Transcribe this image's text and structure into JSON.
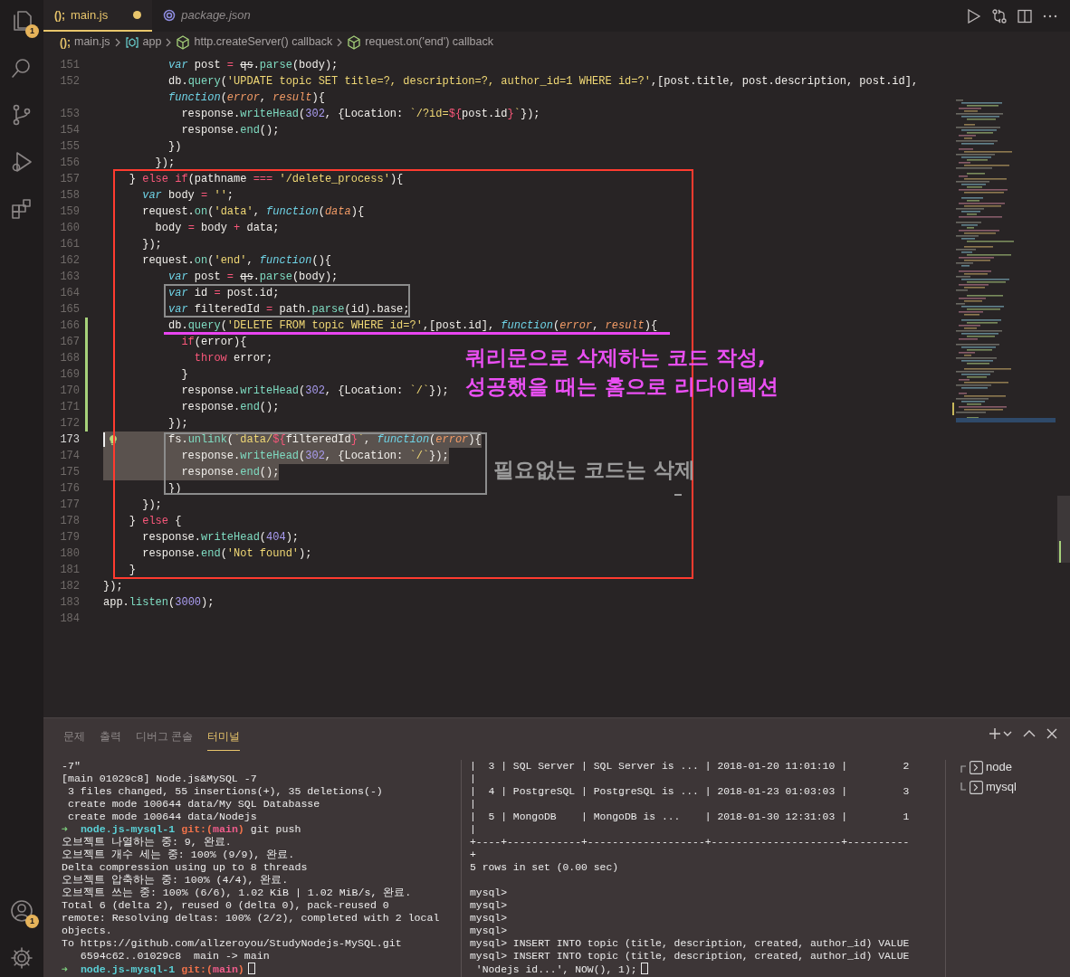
{
  "activity_bar": {
    "top": [
      {
        "kind": "explorer",
        "badge": "1"
      },
      {
        "kind": "search"
      },
      {
        "kind": "source-control"
      },
      {
        "kind": "run"
      },
      {
        "kind": "extensions"
      }
    ],
    "bottom": [
      {
        "kind": "accounts",
        "badge": "1"
      },
      {
        "kind": "settings"
      }
    ]
  },
  "editor": {
    "tabs": [
      {
        "label": "main.js",
        "kind": "js",
        "icon_text": "();",
        "modified": true,
        "preview": false,
        "selected": true
      },
      {
        "label": "package.json",
        "kind": "json",
        "modified": false,
        "preview": true,
        "selected": false
      }
    ],
    "breadcrumbs": [
      {
        "label": "main.js",
        "kind": "file",
        "icon_text": "();"
      },
      {
        "label": "app",
        "kind": "variable"
      },
      {
        "label": "http.createServer() callback",
        "kind": "method"
      },
      {
        "label": "request.on('end') callback",
        "kind": "method"
      }
    ],
    "lines": [
      {
        "number": "151",
        "modified": false,
        "current": false,
        "selected": false,
        "tokens": [
          {
            "kind": "st",
            "text": "          var"
          },
          {
            "kind": "p",
            "text": " post "
          },
          {
            "kind": "op",
            "text": "= "
          },
          {
            "kind": "x",
            "text": "qs"
          },
          {
            "kind": "p",
            "text": "."
          },
          {
            "kind": "fn",
            "text": "parse"
          },
          {
            "kind": "p",
            "text": "(body);"
          }
        ]
      },
      {
        "number": "152",
        "modified": false,
        "current": false,
        "selected": false,
        "tokens": [
          {
            "kind": "p",
            "text": "          db."
          },
          {
            "kind": "fn",
            "text": "query"
          },
          {
            "kind": "p",
            "text": "("
          },
          {
            "kind": "s",
            "text": "'UPDATE topic SET title=?, description=?, author_id=1 WHERE id=?'"
          },
          {
            "kind": "p",
            "text": ",[post.title, post.description, post.id],"
          }
        ],
        "wrap_tokens": [
          {
            "kind": "st",
            "text": "          function"
          },
          {
            "kind": "p",
            "text": "("
          },
          {
            "kind": "pa",
            "text": "error"
          },
          {
            "kind": "p",
            "text": ", "
          },
          {
            "kind": "pa",
            "text": "result"
          },
          {
            "kind": "p",
            "text": "){"
          }
        ]
      },
      {
        "number": "153",
        "modified": false,
        "current": false,
        "selected": false,
        "tokens": [
          {
            "kind": "p",
            "text": "            response."
          },
          {
            "kind": "fn",
            "text": "writeHead"
          },
          {
            "kind": "p",
            "text": "("
          },
          {
            "kind": "n",
            "text": "302"
          },
          {
            "kind": "p",
            "text": ", {Location: "
          },
          {
            "kind": "s",
            "text": "`/?id="
          },
          {
            "kind": "op",
            "text": "${"
          },
          {
            "kind": "p",
            "text": "post.id"
          },
          {
            "kind": "op",
            "text": "}"
          },
          {
            "kind": "s",
            "text": "`"
          },
          {
            "kind": "p",
            "text": "});"
          }
        ]
      },
      {
        "number": "154",
        "modified": false,
        "current": false,
        "selected": false,
        "tokens": [
          {
            "kind": "p",
            "text": "            response."
          },
          {
            "kind": "fn",
            "text": "end"
          },
          {
            "kind": "p",
            "text": "();"
          }
        ]
      },
      {
        "number": "155",
        "modified": false,
        "current": false,
        "selected": false,
        "tokens": [
          {
            "kind": "p",
            "text": "          })"
          }
        ]
      },
      {
        "number": "156",
        "modified": false,
        "current": false,
        "selected": false,
        "tokens": [
          {
            "kind": "p",
            "text": "        });"
          }
        ]
      },
      {
        "number": "157",
        "modified": false,
        "current": false,
        "selected": false,
        "tokens": [
          {
            "kind": "p",
            "text": "    } "
          },
          {
            "kind": "op",
            "text": "else if"
          },
          {
            "kind": "p",
            "text": "(pathname "
          },
          {
            "kind": "op",
            "text": "=== "
          },
          {
            "kind": "s",
            "text": "'/delete_process'"
          },
          {
            "kind": "p",
            "text": "){"
          }
        ]
      },
      {
        "number": "158",
        "modified": false,
        "current": false,
        "selected": false,
        "tokens": [
          {
            "kind": "st",
            "text": "      var"
          },
          {
            "kind": "p",
            "text": " body "
          },
          {
            "kind": "op",
            "text": "= "
          },
          {
            "kind": "s",
            "text": "''"
          },
          {
            "kind": "p",
            "text": ";"
          }
        ]
      },
      {
        "number": "159",
        "modified": false,
        "current": false,
        "selected": false,
        "tokens": [
          {
            "kind": "p",
            "text": "      request."
          },
          {
            "kind": "fn",
            "text": "on"
          },
          {
            "kind": "p",
            "text": "("
          },
          {
            "kind": "s",
            "text": "'data'"
          },
          {
            "kind": "p",
            "text": ", "
          },
          {
            "kind": "st",
            "text": "function"
          },
          {
            "kind": "p",
            "text": "("
          },
          {
            "kind": "pa",
            "text": "data"
          },
          {
            "kind": "p",
            "text": "){"
          }
        ]
      },
      {
        "number": "160",
        "modified": false,
        "current": false,
        "selected": false,
        "tokens": [
          {
            "kind": "p",
            "text": "        body "
          },
          {
            "kind": "op",
            "text": "="
          },
          {
            "kind": "p",
            "text": " body "
          },
          {
            "kind": "op",
            "text": "+"
          },
          {
            "kind": "p",
            "text": " data;"
          }
        ]
      },
      {
        "number": "161",
        "modified": false,
        "current": false,
        "selected": false,
        "tokens": [
          {
            "kind": "p",
            "text": "      });"
          }
        ]
      },
      {
        "number": "162",
        "modified": false,
        "current": false,
        "selected": false,
        "tokens": [
          {
            "kind": "p",
            "text": "      request."
          },
          {
            "kind": "fn",
            "text": "on"
          },
          {
            "kind": "p",
            "text": "("
          },
          {
            "kind": "s",
            "text": "'end'"
          },
          {
            "kind": "p",
            "text": ", "
          },
          {
            "kind": "st",
            "text": "function"
          },
          {
            "kind": "p",
            "text": "(){"
          }
        ]
      },
      {
        "number": "163",
        "modified": false,
        "current": false,
        "selected": false,
        "tokens": [
          {
            "kind": "st",
            "text": "          var"
          },
          {
            "kind": "p",
            "text": " post "
          },
          {
            "kind": "op",
            "text": "= "
          },
          {
            "kind": "x",
            "text": "qs"
          },
          {
            "kind": "p",
            "text": "."
          },
          {
            "kind": "fn",
            "text": "parse"
          },
          {
            "kind": "p",
            "text": "(body);"
          }
        ]
      },
      {
        "number": "164",
        "modified": false,
        "current": false,
        "selected": false,
        "tokens": [
          {
            "kind": "st",
            "text": "          var"
          },
          {
            "kind": "p",
            "text": " id "
          },
          {
            "kind": "op",
            "text": "="
          },
          {
            "kind": "p",
            "text": " post.id;"
          }
        ]
      },
      {
        "number": "165",
        "modified": false,
        "current": false,
        "selected": false,
        "tokens": [
          {
            "kind": "st",
            "text": "          var"
          },
          {
            "kind": "p",
            "text": " filteredId "
          },
          {
            "kind": "op",
            "text": "="
          },
          {
            "kind": "p",
            "text": " path."
          },
          {
            "kind": "fn",
            "text": "parse"
          },
          {
            "kind": "p",
            "text": "(id).base;"
          }
        ]
      },
      {
        "number": "166",
        "modified": true,
        "current": false,
        "selected": false,
        "tokens": [
          {
            "kind": "p",
            "text": "          db."
          },
          {
            "kind": "fn",
            "text": "query"
          },
          {
            "kind": "p",
            "text": "("
          },
          {
            "kind": "s",
            "text": "'DELETE FROM topic WHERE id=?'"
          },
          {
            "kind": "p",
            "text": ",[post.id], "
          },
          {
            "kind": "st",
            "text": "function"
          },
          {
            "kind": "p",
            "text": "("
          },
          {
            "kind": "pa",
            "text": "error"
          },
          {
            "kind": "p",
            "text": ", "
          },
          {
            "kind": "pa",
            "text": "result"
          },
          {
            "kind": "p",
            "text": "){"
          }
        ]
      },
      {
        "number": "167",
        "modified": true,
        "current": false,
        "selected": false,
        "tokens": [
          {
            "kind": "op",
            "text": "            if"
          },
          {
            "kind": "p",
            "text": "(error){"
          }
        ]
      },
      {
        "number": "168",
        "modified": true,
        "current": false,
        "selected": false,
        "tokens": [
          {
            "kind": "op",
            "text": "              throw"
          },
          {
            "kind": "p",
            "text": " error;"
          }
        ]
      },
      {
        "number": "169",
        "modified": true,
        "current": false,
        "selected": false,
        "tokens": [
          {
            "kind": "p",
            "text": "            }"
          }
        ]
      },
      {
        "number": "170",
        "modified": true,
        "current": false,
        "selected": false,
        "tokens": [
          {
            "kind": "p",
            "text": "            response."
          },
          {
            "kind": "fn",
            "text": "writeHead"
          },
          {
            "kind": "p",
            "text": "("
          },
          {
            "kind": "n",
            "text": "302"
          },
          {
            "kind": "p",
            "text": ", {Location: "
          },
          {
            "kind": "s",
            "text": "`/`"
          },
          {
            "kind": "p",
            "text": "});"
          }
        ]
      },
      {
        "number": "171",
        "modified": true,
        "current": false,
        "selected": false,
        "tokens": [
          {
            "kind": "p",
            "text": "            response."
          },
          {
            "kind": "fn",
            "text": "end"
          },
          {
            "kind": "p",
            "text": "();"
          }
        ]
      },
      {
        "number": "172",
        "modified": true,
        "current": false,
        "selected": false,
        "tokens": [
          {
            "kind": "p",
            "text": "          });"
          }
        ]
      },
      {
        "number": "173",
        "modified": false,
        "current": true,
        "selected": true,
        "tokens": [
          {
            "kind": "p",
            "text": "          fs."
          },
          {
            "kind": "fn",
            "text": "unlink"
          },
          {
            "kind": "p",
            "text": "("
          },
          {
            "kind": "s",
            "text": "`data/"
          },
          {
            "kind": "op",
            "text": "${"
          },
          {
            "kind": "p",
            "text": "filteredId"
          },
          {
            "kind": "op",
            "text": "}"
          },
          {
            "kind": "s",
            "text": "`"
          },
          {
            "kind": "p",
            "text": ", "
          },
          {
            "kind": "st",
            "text": "function"
          },
          {
            "kind": "p",
            "text": "("
          },
          {
            "kind": "pa",
            "text": "error"
          },
          {
            "kind": "p",
            "text": "){"
          }
        ]
      },
      {
        "number": "174",
        "modified": false,
        "current": false,
        "selected": true,
        "tokens": [
          {
            "kind": "p",
            "text": "            response."
          },
          {
            "kind": "fn",
            "text": "writeHead"
          },
          {
            "kind": "p",
            "text": "("
          },
          {
            "kind": "n",
            "text": "302"
          },
          {
            "kind": "p",
            "text": ", {Location: "
          },
          {
            "kind": "s",
            "text": "`/`"
          },
          {
            "kind": "p",
            "text": "});"
          }
        ]
      },
      {
        "number": "175",
        "modified": false,
        "current": false,
        "selected": true,
        "tokens": [
          {
            "kind": "p",
            "text": "            response."
          },
          {
            "kind": "fn",
            "text": "end"
          },
          {
            "kind": "p",
            "text": "();"
          }
        ]
      },
      {
        "number": "176",
        "modified": false,
        "current": false,
        "selected": false,
        "tokens": [
          {
            "kind": "p",
            "text": "          })"
          }
        ]
      },
      {
        "number": "177",
        "modified": false,
        "current": false,
        "selected": false,
        "tokens": [
          {
            "kind": "p",
            "text": "      });"
          }
        ]
      },
      {
        "number": "178",
        "modified": false,
        "current": false,
        "selected": false,
        "tokens": [
          {
            "kind": "p",
            "text": "    } "
          },
          {
            "kind": "op",
            "text": "else"
          },
          {
            "kind": "p",
            "text": " {"
          }
        ]
      },
      {
        "number": "179",
        "modified": false,
        "current": false,
        "selected": false,
        "tokens": [
          {
            "kind": "p",
            "text": "      response."
          },
          {
            "kind": "fn",
            "text": "writeHead"
          },
          {
            "kind": "p",
            "text": "("
          },
          {
            "kind": "n",
            "text": "404"
          },
          {
            "kind": "p",
            "text": ");"
          }
        ]
      },
      {
        "number": "180",
        "modified": false,
        "current": false,
        "selected": false,
        "tokens": [
          {
            "kind": "p",
            "text": "      response."
          },
          {
            "kind": "fn",
            "text": "end"
          },
          {
            "kind": "p",
            "text": "("
          },
          {
            "kind": "s",
            "text": "'Not found'"
          },
          {
            "kind": "p",
            "text": ");"
          }
        ]
      },
      {
        "number": "181",
        "modified": false,
        "current": false,
        "selected": false,
        "tokens": [
          {
            "kind": "p",
            "text": "    }"
          }
        ]
      },
      {
        "number": "182",
        "modified": false,
        "current": false,
        "selected": false,
        "tokens": [
          {
            "kind": "p",
            "text": "});"
          }
        ]
      },
      {
        "number": "183",
        "modified": false,
        "current": false,
        "selected": false,
        "tokens": [
          {
            "kind": "p",
            "text": "app."
          },
          {
            "kind": "fn",
            "text": "listen"
          },
          {
            "kind": "p",
            "text": "("
          },
          {
            "kind": "n",
            "text": "3000"
          },
          {
            "kind": "p",
            "text": ");"
          }
        ]
      },
      {
        "number": "184",
        "modified": false,
        "current": false,
        "selected": false
      }
    ],
    "annotations": [
      {
        "kind": "frame",
        "color": "#ff3b2f"
      },
      {
        "kind": "frame",
        "color": "#8c8c8c"
      },
      {
        "kind": "underline",
        "color": "#e845f0"
      },
      {
        "kind": "frame",
        "color": "#8c8c8c"
      },
      {
        "kind": "note",
        "color": "#e94ff2",
        "lines": [
          "쿼리문으로 삭제하는 코드 작성,",
          "성공했을 때는 홈으로 리다이렉션"
        ]
      },
      {
        "kind": "note",
        "color": "#9a9a9a",
        "lines": [
          "필요없는 코드는 삭제"
        ]
      },
      {
        "kind": "dash",
        "color": "#9a9a9a"
      }
    ]
  },
  "panel": {
    "tabs": [
      {
        "label": "문제",
        "selected": false
      },
      {
        "label": "출력",
        "selected": false
      },
      {
        "label": "디버그 콘솔",
        "selected": false
      },
      {
        "label": "터미널",
        "selected": true
      }
    ],
    "terminal_left": {
      "lines": [
        {
          "text": "-7\"",
          "cursor": false
        },
        {
          "text": "[main 01029c8] Node.js&MySQL -7",
          "cursor": false
        },
        {
          "text": " 3 files changed, 55 insertions(+), 35 deletions(-)",
          "cursor": false
        },
        {
          "text": " create mode 100644 data/My SQL Databasse",
          "cursor": false
        },
        {
          "text": " create mode 100644 data/Nodejs",
          "cursor": false
        },
        {
          "cursor": false,
          "segments": [
            {
              "kind": "arrow",
              "text": "➜"
            },
            {
              "kind": "dir",
              "text": "  node.js-mysql-1"
            },
            {
              "kind": "git",
              "text": " git:("
            },
            {
              "kind": "branch",
              "text": "main"
            },
            {
              "kind": "git",
              "text": ")"
            },
            {
              "kind": "p",
              "text": " git push"
            }
          ]
        },
        {
          "text": "오브젝트 나열하는 중: 9, 완료.",
          "cursor": false
        },
        {
          "text": "오브젝트 개수 세는 중: 100% (9/9), 완료.",
          "cursor": false
        },
        {
          "text": "Delta compression using up to 8 threads",
          "cursor": false
        },
        {
          "text": "오브젝트 압축하는 중: 100% (4/4), 완료.",
          "cursor": false
        },
        {
          "text": "오브젝트 쓰는 중: 100% (6/6), 1.02 KiB | 1.02 MiB/s, 완료.",
          "cursor": false
        },
        {
          "text": "Total 6 (delta 2), reused 0 (delta 0), pack-reused 0",
          "cursor": false
        },
        {
          "text": "remote: Resolving deltas: 100% (2/2), completed with 2 local",
          "cursor": false
        },
        {
          "text": "objects.",
          "cursor": false
        },
        {
          "text": "To https://github.com/allzeroyou/StudyNodejs-MySQL.git",
          "cursor": false
        },
        {
          "text": "   6594c62..01029c8  main -> main",
          "cursor": false
        },
        {
          "cursor": true,
          "segments": [
            {
              "kind": "arrow",
              "text": "➜"
            },
            {
              "kind": "dir",
              "text": "  node.js-mysql-1"
            },
            {
              "kind": "git",
              "text": " git:("
            },
            {
              "kind": "branch",
              "text": "main"
            },
            {
              "kind": "git",
              "text": ")"
            }
          ]
        }
      ]
    },
    "terminal_right": {
      "lines": [
        {
          "text": "|  3 | SQL Server | SQL Server is ... | 2018-01-20 11:01:10 |         2",
          "cursor": false
        },
        {
          "text": "|",
          "cursor": false
        },
        {
          "text": "|  4 | PostgreSQL | PostgreSQL is ... | 2018-01-23 01:03:03 |         3",
          "cursor": false
        },
        {
          "text": "|",
          "cursor": false
        },
        {
          "text": "|  5 | MongoDB    | MongoDB is ...    | 2018-01-30 12:31:03 |         1",
          "cursor": false
        },
        {
          "text": "|",
          "cursor": false
        },
        {
          "text": "+----+------------+-------------------+---------------------+----------",
          "cursor": false
        },
        {
          "text": "+",
          "cursor": false
        },
        {
          "text": "5 rows in set (0.00 sec)",
          "cursor": false
        },
        {
          "kind": "blank",
          "cursor": false
        },
        {
          "text": "mysql>",
          "cursor": false
        },
        {
          "text": "mysql>",
          "cursor": false
        },
        {
          "text": "mysql>",
          "cursor": false
        },
        {
          "text": "mysql>",
          "cursor": false
        },
        {
          "text": "mysql> INSERT INTO topic (title, description, created, author_id) VALUE",
          "cursor": false
        },
        {
          "text": "mysql> INSERT INTO topic (title, description, created, author_id) VALUE",
          "cursor": false
        },
        {
          "text": " 'Nodejs id...', NOW(), 1);",
          "cursor": true
        }
      ]
    },
    "sessions": [
      {
        "label": "node"
      },
      {
        "label": "mysql"
      }
    ]
  }
}
